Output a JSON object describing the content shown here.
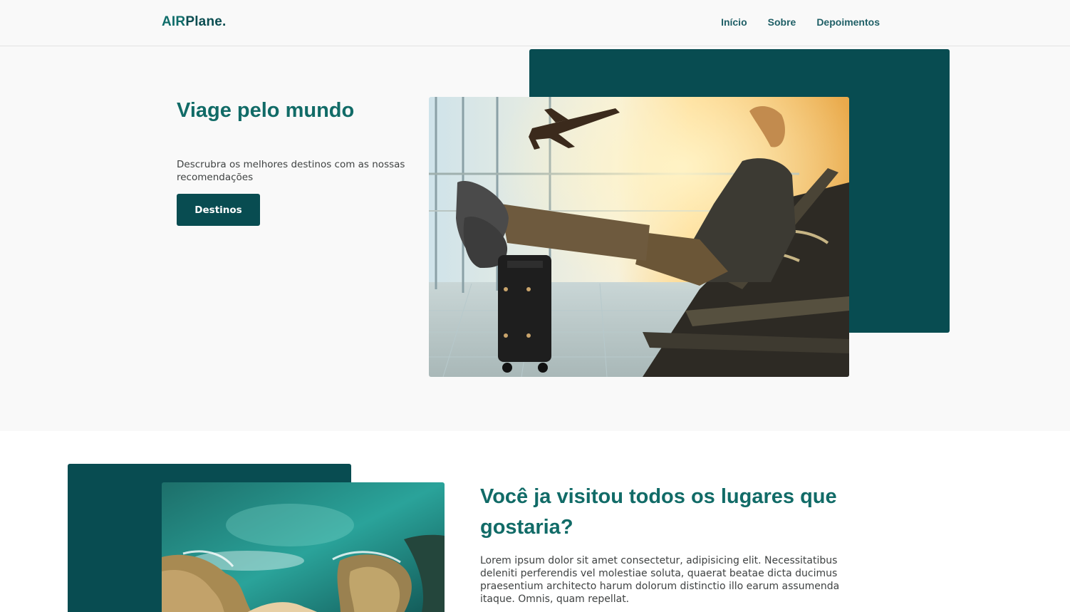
{
  "header": {
    "logo_part1": "AIR",
    "logo_part2": "Plane.",
    "nav": [
      "Início",
      "Sobre",
      "Depoimentos"
    ]
  },
  "hero": {
    "title": "Viage pelo mundo",
    "description": "Descrubra os melhores destinos com as nossas recomendações",
    "button_label": "Destinos",
    "image": "airport-traveler-photo"
  },
  "section2": {
    "title": "Você ja visitou todos os lugares que gostaria?",
    "text": "Lorem ipsum dolor sit amet consectetur, adipisicing elit. Necessitatibus deleniti perferendis vel molestiae soluta, quaerat beatae dicta ducimus praesentium architecto harum dolorum distinctio illo earum assumenda itaque. Omnis, quam repellat.",
    "image": "coastline-aerial-photo"
  },
  "colors": {
    "brand_dark": "#084c51",
    "brand_title": "#116b67",
    "page_bg": "#f9f9f9"
  }
}
